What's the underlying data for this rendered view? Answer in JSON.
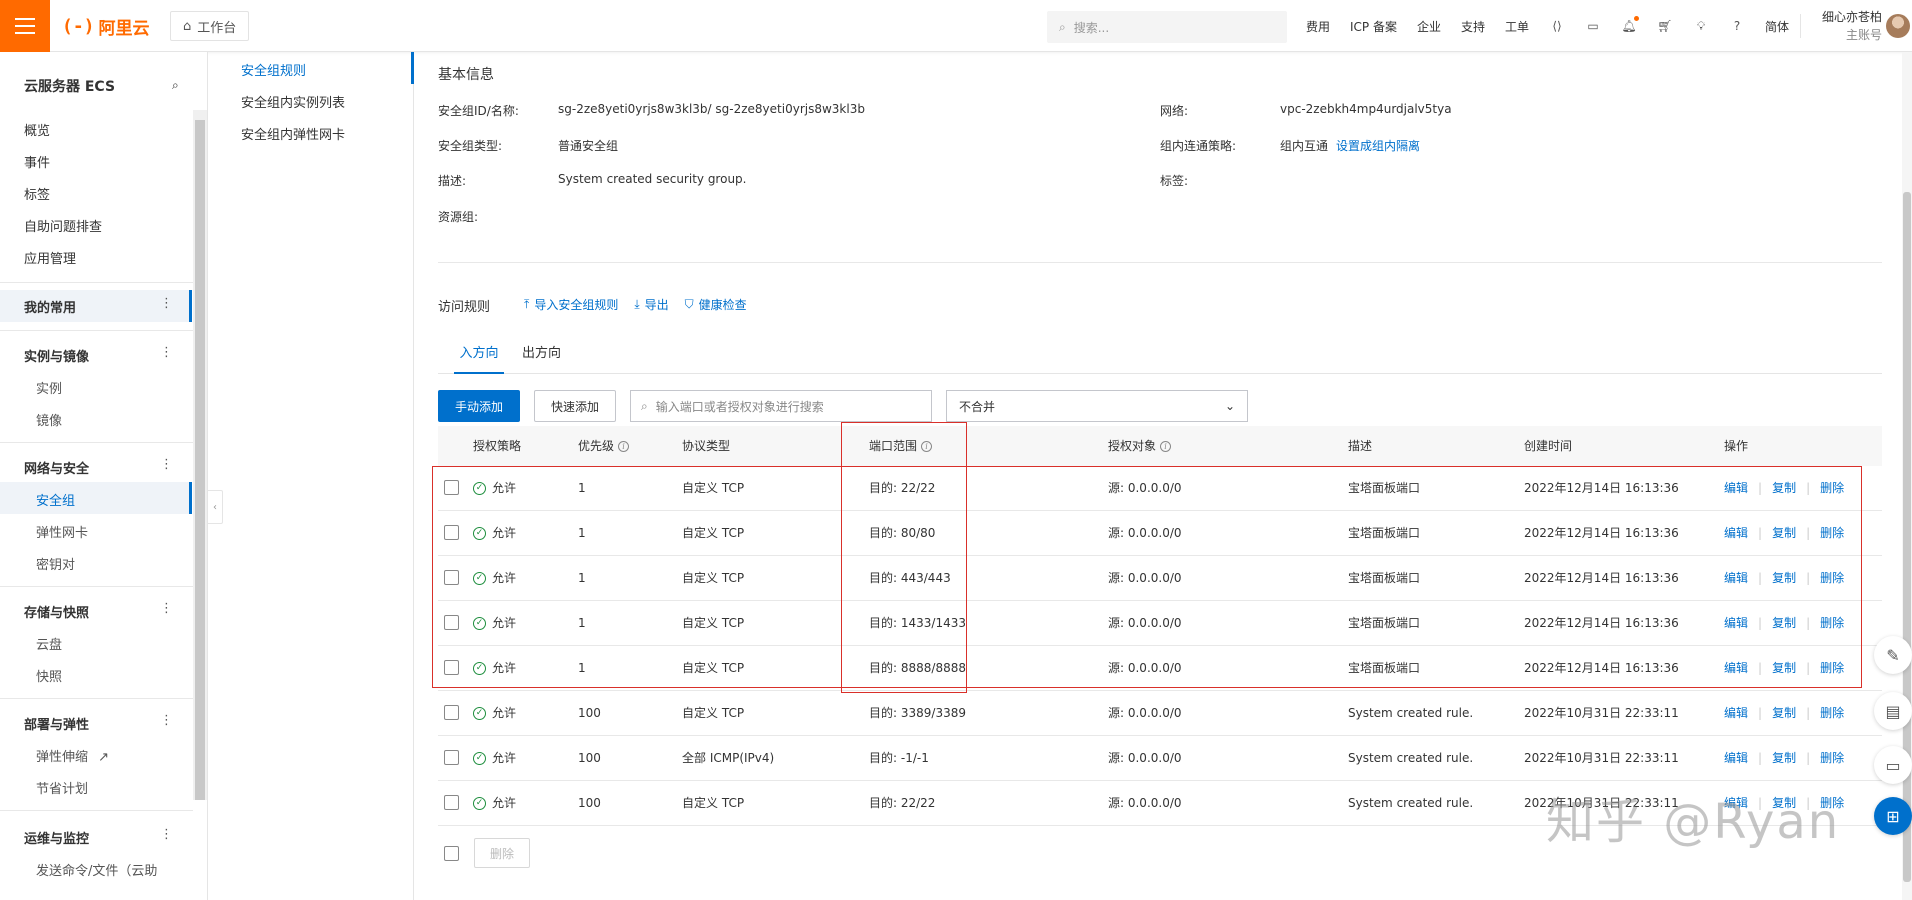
{
  "topbar": {
    "logo_text": "阿里云",
    "logo_mark": "(-)",
    "workbench": "工作台",
    "search_placeholder": "搜索...",
    "nav": [
      "费用",
      "ICP 备案",
      "企业",
      "支持",
      "工单"
    ],
    "lang": "简体",
    "user_name": "细心亦苍柏",
    "user_role": "主账号"
  },
  "sidebar": {
    "title": "云服务器 ECS",
    "items": [
      "概览",
      "事件",
      "标签",
      "自助问题排查",
      "应用管理"
    ],
    "favorites": "我的常用",
    "groups": [
      {
        "label": "实例与镜像",
        "items": [
          "实例",
          "镜像"
        ]
      },
      {
        "label": "网络与安全",
        "items": [
          "安全组",
          "弹性网卡",
          "密钥对"
        ]
      },
      {
        "label": "存储与快照",
        "items": [
          "云盘",
          "快照"
        ]
      },
      {
        "label": "部署与弹性",
        "items": [
          "弹性伸缩",
          "节省计划"
        ]
      },
      {
        "label": "运维与监控",
        "items": [
          "发送命令/文件（云助"
        ]
      }
    ]
  },
  "subnav": {
    "items": [
      "安全组规则",
      "安全组内实例列表",
      "安全组内弹性网卡"
    ]
  },
  "basic_info": {
    "title": "基本信息",
    "id_label": "安全组ID/名称:",
    "id_value": "sg-2ze8yeti0yrjs8w3kl3b/ sg-2ze8yeti0yrjs8w3kl3b",
    "type_label": "安全组类型:",
    "type_value": "普通安全组",
    "desc_label": "描述:",
    "desc_value": "System created security group.",
    "rg_label": "资源组:",
    "network_label": "网络:",
    "network_value": "vpc-2zebkh4mp4urdjalv5tya",
    "policy_label": "组内连通策略:",
    "policy_value": "组内互通",
    "policy_link": "设置成组内隔离",
    "tag_label": "标签:"
  },
  "access": {
    "title": "访问规则",
    "actions": [
      "导入安全组规则",
      "导出",
      "健康检查"
    ],
    "tabs": [
      "入方向",
      "出方向"
    ],
    "add_manual": "手动添加",
    "add_quick": "快速添加",
    "filter_placeholder": "输入端口或者授权对象进行搜索",
    "merge_select": "不合并"
  },
  "table": {
    "headers": [
      "授权策略",
      "优先级",
      "协议类型",
      "端口范围",
      "授权对象",
      "描述",
      "创建时间",
      "操作"
    ],
    "rows": [
      {
        "policy": "允许",
        "priority": "1",
        "protocol": "自定义 TCP",
        "port": "目的: 22/22",
        "target": "源: 0.0.0.0/0",
        "desc": "宝塔面板端口",
        "time": "2022年12月14日 16:13:36"
      },
      {
        "policy": "允许",
        "priority": "1",
        "protocol": "自定义 TCP",
        "port": "目的: 80/80",
        "target": "源: 0.0.0.0/0",
        "desc": "宝塔面板端口",
        "time": "2022年12月14日 16:13:36"
      },
      {
        "policy": "允许",
        "priority": "1",
        "protocol": "自定义 TCP",
        "port": "目的: 443/443",
        "target": "源: 0.0.0.0/0",
        "desc": "宝塔面板端口",
        "time": "2022年12月14日 16:13:36"
      },
      {
        "policy": "允许",
        "priority": "1",
        "protocol": "自定义 TCP",
        "port": "目的: 1433/1433",
        "target": "源: 0.0.0.0/0",
        "desc": "宝塔面板端口",
        "time": "2022年12月14日 16:13:36"
      },
      {
        "policy": "允许",
        "priority": "1",
        "protocol": "自定义 TCP",
        "port": "目的: 8888/8888",
        "target": "源: 0.0.0.0/0",
        "desc": "宝塔面板端口",
        "time": "2022年12月14日 16:13:36"
      },
      {
        "policy": "允许",
        "priority": "100",
        "protocol": "自定义 TCP",
        "port": "目的: 3389/3389",
        "target": "源: 0.0.0.0/0",
        "desc": "System created rule.",
        "time": "2022年10月31日 22:33:11"
      },
      {
        "policy": "允许",
        "priority": "100",
        "protocol": "全部 ICMP(IPv4)",
        "port": "目的: -1/-1",
        "target": "源: 0.0.0.0/0",
        "desc": "System created rule.",
        "time": "2022年10月31日 22:33:11"
      },
      {
        "policy": "允许",
        "priority": "100",
        "protocol": "自定义 TCP",
        "port": "目的: 22/22",
        "target": "源: 0.0.0.0/0",
        "desc": "System created rule.",
        "time": "2022年10月31日 22:33:11"
      }
    ],
    "op_edit": "编辑",
    "op_copy": "复制",
    "op_delete": "删除",
    "bulk_delete": "删除"
  },
  "watermark": "知乎 @Ryan",
  "colors": {
    "brand": "#ff6a00",
    "primary": "#0070cc",
    "highlight": "#d9302a",
    "allow": "#1e8e3e"
  }
}
